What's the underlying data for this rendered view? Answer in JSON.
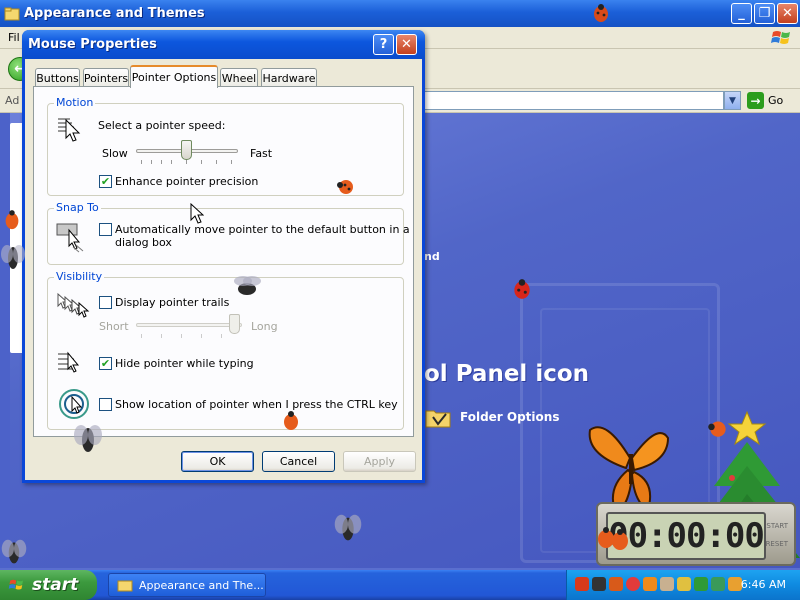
{
  "background_window": {
    "title": "Appearance and Themes",
    "menu_partial": "Fil",
    "address_partial": "Ad",
    "go_label": "Go",
    "partial_text": "nd",
    "panel_heading": "ol Panel icon",
    "folder_options": "Folder Options",
    "buttons": {
      "minimize": "_",
      "maximize": "❐",
      "close": "✕"
    }
  },
  "dialog": {
    "title": "Mouse Properties",
    "help": "?",
    "close": "✕",
    "tabs": [
      "Buttons",
      "Pointers",
      "Pointer Options",
      "Wheel",
      "Hardware"
    ],
    "active_tab": "Pointer Options",
    "motion": {
      "label": "Motion",
      "speed_label": "Select a pointer speed:",
      "slow": "Slow",
      "fast": "Fast",
      "speed_value": 0.5,
      "enhance_label": "Enhance pointer precision",
      "enhance_checked": true
    },
    "snap": {
      "label": "Snap To",
      "auto_line1": "Automatically move pointer to the default button in a",
      "auto_line2": "dialog box",
      "auto_checked": false
    },
    "visibility": {
      "label": "Visibility",
      "trails_label": "Display pointer trails",
      "trails_checked": false,
      "short": "Short",
      "long": "Long",
      "trail_value": 1.0,
      "hide_label": "Hide pointer while typing",
      "hide_checked": true,
      "ctrl_label": "Show location of pointer when I press the CTRL key",
      "ctrl_checked": false
    },
    "buttons": {
      "ok": "OK",
      "cancel": "Cancel",
      "apply": "Apply"
    }
  },
  "taskbar": {
    "start": "start",
    "task_item": "Appearance and The...",
    "clock": "6:46 AM"
  },
  "widget": {
    "time": "00:00:00",
    "side_top": "START",
    "side_bottom": "RESET"
  },
  "colors": {
    "xp_blue": "#0a47d8",
    "desktop": "#5a6fcf",
    "groupbox_label": "#0046d5",
    "start_green": "#3c9a3e"
  }
}
